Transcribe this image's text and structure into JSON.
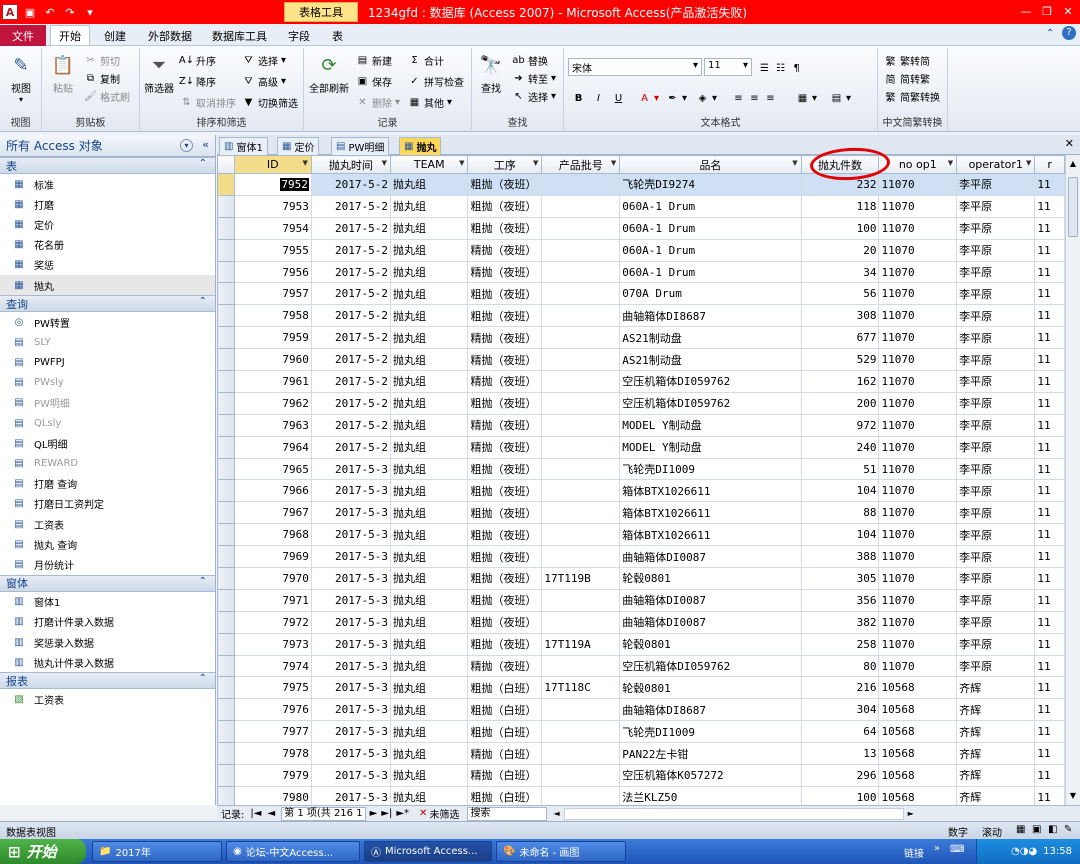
{
  "titlebar": {
    "app_icon": "A",
    "context_tab": "表格工具",
    "title": "1234gfd : 数据库 (Access 2007)  -  Microsoft Access(产品激活失败)",
    "qat_icons": [
      "save-icon",
      "undo-icon",
      "redo-icon",
      "customize-icon"
    ],
    "win_controls": [
      "—",
      "❐",
      "✕"
    ]
  },
  "ribbon_tabs": [
    "文件",
    "开始",
    "创建",
    "外部数据",
    "数据库工具",
    "字段",
    "表"
  ],
  "ribbon": {
    "view": {
      "label": "视图",
      "group": "视图"
    },
    "clipboard": {
      "paste": "粘贴",
      "cut": "剪切",
      "copy": "复制",
      "format_painter": "格式刷",
      "group": "剪贴板"
    },
    "sort_filter": {
      "filter": "筛选器",
      "asc": "升序",
      "desc": "降序",
      "clear_sort": "取消排序",
      "selection": "选择",
      "advanced": "高级",
      "toggle_filter": "切换筛选",
      "group": "排序和筛选"
    },
    "records": {
      "refresh_all": "全部刷新",
      "new": "新建",
      "save": "保存",
      "delete": "删除",
      "totals": "合计",
      "spelling": "拼写检查",
      "more": "其他",
      "group": "记录"
    },
    "find": {
      "find": "查找",
      "replace": "替换",
      "goto": "转至",
      "select": "选择",
      "group": "查找"
    },
    "text_format": {
      "font": "宋体",
      "size": "11",
      "group": "文本格式"
    },
    "chinese_conv": {
      "t2s": "繁转简",
      "s2t": "简转繁",
      "conv": "简繁转换",
      "group": "中文简繁转换"
    }
  },
  "nav": {
    "header": "所有 Access 对象",
    "sections": [
      {
        "title": "表",
        "items": [
          {
            "label": "标准",
            "icon": "table-icon"
          },
          {
            "label": "打磨",
            "icon": "table-icon"
          },
          {
            "label": "定价",
            "icon": "table-icon"
          },
          {
            "label": "花名册",
            "icon": "table-icon"
          },
          {
            "label": "奖惩",
            "icon": "table-icon"
          },
          {
            "label": "抛丸",
            "icon": "table-icon",
            "selected": true
          }
        ]
      },
      {
        "title": "查询",
        "items": [
          {
            "label": "PW转置",
            "icon": "crosstab-query-icon"
          },
          {
            "label": "SLY",
            "icon": "query-icon",
            "dimmed": true
          },
          {
            "label": "PWFPJ",
            "icon": "query-icon"
          },
          {
            "label": "PWsly",
            "icon": "query-icon",
            "dimmed": true
          },
          {
            "label": "PW明细",
            "icon": "query-icon",
            "dimmed": true
          },
          {
            "label": "QLsly",
            "icon": "query-icon",
            "dimmed": true
          },
          {
            "label": "QL明细",
            "icon": "query-icon"
          },
          {
            "label": "REWARD",
            "icon": "query-icon",
            "dimmed": true
          },
          {
            "label": "打磨 查询",
            "icon": "query-icon"
          },
          {
            "label": "打磨日工资判定",
            "icon": "query-icon"
          },
          {
            "label": "工资表",
            "icon": "query-icon"
          },
          {
            "label": "抛丸 查询",
            "icon": "query-icon"
          },
          {
            "label": "月份统计",
            "icon": "query-icon"
          }
        ]
      },
      {
        "title": "窗体",
        "items": [
          {
            "label": "窗体1",
            "icon": "form-icon"
          },
          {
            "label": "打磨计件录入数据",
            "icon": "form-icon"
          },
          {
            "label": "奖惩录入数据",
            "icon": "form-icon"
          },
          {
            "label": "抛丸计件录入数据",
            "icon": "form-icon"
          }
        ]
      },
      {
        "title": "报表",
        "items": [
          {
            "label": "工资表",
            "icon": "report-icon"
          }
        ]
      }
    ]
  },
  "doc_tabs": [
    {
      "label": "窗体1",
      "icon": "form-icon"
    },
    {
      "label": "定价",
      "icon": "table-icon"
    },
    {
      "label": "PW明细",
      "icon": "query-icon"
    },
    {
      "label": "抛丸",
      "icon": "table-icon",
      "active": true
    }
  ],
  "grid": {
    "columns": [
      "ID",
      "抛丸时间",
      "TEAM",
      "工序",
      "产品批号",
      "品名",
      "抛丸件数",
      "no op1",
      "operator1",
      "r"
    ],
    "rows": [
      [
        "7952",
        "2017-5-2",
        "抛丸组",
        "粗抛（夜班）",
        "",
        "飞轮壳DI9274",
        "232",
        "11070",
        "李平原",
        "11"
      ],
      [
        "7953",
        "2017-5-2",
        "抛丸组",
        "粗抛（夜班）",
        "",
        "060A-1 Drum",
        "118",
        "11070",
        "李平原",
        "11"
      ],
      [
        "7954",
        "2017-5-2",
        "抛丸组",
        "粗抛（夜班）",
        "",
        "060A-1 Drum",
        "100",
        "11070",
        "李平原",
        "11"
      ],
      [
        "7955",
        "2017-5-2",
        "抛丸组",
        "精抛（夜班）",
        "",
        "060A-1 Drum",
        "20",
        "11070",
        "李平原",
        "11"
      ],
      [
        "7956",
        "2017-5-2",
        "抛丸组",
        "精抛（夜班）",
        "",
        "060A-1 Drum",
        "34",
        "11070",
        "李平原",
        "11"
      ],
      [
        "7957",
        "2017-5-2",
        "抛丸组",
        "粗抛（夜班）",
        "",
        "070A Drum",
        "56",
        "11070",
        "李平原",
        "11"
      ],
      [
        "7958",
        "2017-5-2",
        "抛丸组",
        "粗抛（夜班）",
        "",
        "曲轴箱体DI8687",
        "308",
        "11070",
        "李平原",
        "11"
      ],
      [
        "7959",
        "2017-5-2",
        "抛丸组",
        "精抛（夜班）",
        "",
        "AS21制动盘",
        "677",
        "11070",
        "李平原",
        "11"
      ],
      [
        "7960",
        "2017-5-2",
        "抛丸组",
        "精抛（夜班）",
        "",
        "AS21制动盘",
        "529",
        "11070",
        "李平原",
        "11"
      ],
      [
        "7961",
        "2017-5-2",
        "抛丸组",
        "精抛（夜班）",
        "",
        "空压机箱体DI059762",
        "162",
        "11070",
        "李平原",
        "11"
      ],
      [
        "7962",
        "2017-5-2",
        "抛丸组",
        "粗抛（夜班）",
        "",
        "空压机箱体DI059762",
        "200",
        "11070",
        "李平原",
        "11"
      ],
      [
        "7963",
        "2017-5-2",
        "抛丸组",
        "精抛（夜班）",
        "",
        "MODEL Y制动盘",
        "972",
        "11070",
        "李平原",
        "11"
      ],
      [
        "7964",
        "2017-5-2",
        "抛丸组",
        "精抛（夜班）",
        "",
        "MODEL Y制动盘",
        "240",
        "11070",
        "李平原",
        "11"
      ],
      [
        "7965",
        "2017-5-3",
        "抛丸组",
        "粗抛（夜班）",
        "",
        "飞轮壳DI1009",
        "51",
        "11070",
        "李平原",
        "11"
      ],
      [
        "7966",
        "2017-5-3",
        "抛丸组",
        "粗抛（夜班）",
        "",
        "箱体BTX1026611",
        "104",
        "11070",
        "李平原",
        "11"
      ],
      [
        "7967",
        "2017-5-3",
        "抛丸组",
        "粗抛（夜班）",
        "",
        "箱体BTX1026611",
        "88",
        "11070",
        "李平原",
        "11"
      ],
      [
        "7968",
        "2017-5-3",
        "抛丸组",
        "粗抛（夜班）",
        "",
        "箱体BTX1026611",
        "104",
        "11070",
        "李平原",
        "11"
      ],
      [
        "7969",
        "2017-5-3",
        "抛丸组",
        "粗抛（夜班）",
        "",
        "曲轴箱体DI0087",
        "388",
        "11070",
        "李平原",
        "11"
      ],
      [
        "7970",
        "2017-5-3",
        "抛丸组",
        "粗抛（夜班）",
        "17T119B",
        "轮毂0801",
        "305",
        "11070",
        "李平原",
        "11"
      ],
      [
        "7971",
        "2017-5-3",
        "抛丸组",
        "粗抛（夜班）",
        "",
        "曲轴箱体DI0087",
        "356",
        "11070",
        "李平原",
        "11"
      ],
      [
        "7972",
        "2017-5-3",
        "抛丸组",
        "粗抛（夜班）",
        "",
        "曲轴箱体DI0087",
        "382",
        "11070",
        "李平原",
        "11"
      ],
      [
        "7973",
        "2017-5-3",
        "抛丸组",
        "粗抛（夜班）",
        "17T119A",
        "轮毂0801",
        "258",
        "11070",
        "李平原",
        "11"
      ],
      [
        "7974",
        "2017-5-3",
        "抛丸组",
        "精抛（夜班）",
        "",
        "空压机箱体DI059762",
        "80",
        "11070",
        "李平原",
        "11"
      ],
      [
        "7975",
        "2017-5-3",
        "抛丸组",
        "粗抛（白班）",
        "17T118C",
        "轮毂0801",
        "216",
        "10568",
        "齐辉",
        "11"
      ],
      [
        "7976",
        "2017-5-3",
        "抛丸组",
        "粗抛（白班）",
        "",
        "曲轴箱体DI8687",
        "304",
        "10568",
        "齐辉",
        "11"
      ],
      [
        "7977",
        "2017-5-3",
        "抛丸组",
        "粗抛（白班）",
        "",
        "飞轮壳DI1009",
        "64",
        "10568",
        "齐辉",
        "11"
      ],
      [
        "7978",
        "2017-5-3",
        "抛丸组",
        "精抛（白班）",
        "",
        "PAN22左卡钳",
        "13",
        "10568",
        "齐辉",
        "11"
      ],
      [
        "7979",
        "2017-5-3",
        "抛丸组",
        "精抛（白班）",
        "",
        "空压机箱体K057272",
        "296",
        "10568",
        "齐辉",
        "11"
      ],
      [
        "7980",
        "2017-5-3",
        "抛丸组",
        "粗抛（白班）",
        "",
        "法兰KLZ50",
        "100",
        "10568",
        "齐辉",
        "11"
      ]
    ]
  },
  "recnav": {
    "label": "记录:",
    "position": "第 1 项(共 216 1",
    "filter": "未筛选",
    "search": "搜索"
  },
  "status": {
    "left": "数据表视图",
    "num": "数字",
    "scroll": "滚动"
  },
  "taskbar": {
    "start": "开始",
    "tasks": [
      "2017年",
      "论坛-中文Access...",
      "Microsoft Access...",
      "未命名 - 画图"
    ],
    "link": "链接",
    "time": "13:58"
  }
}
